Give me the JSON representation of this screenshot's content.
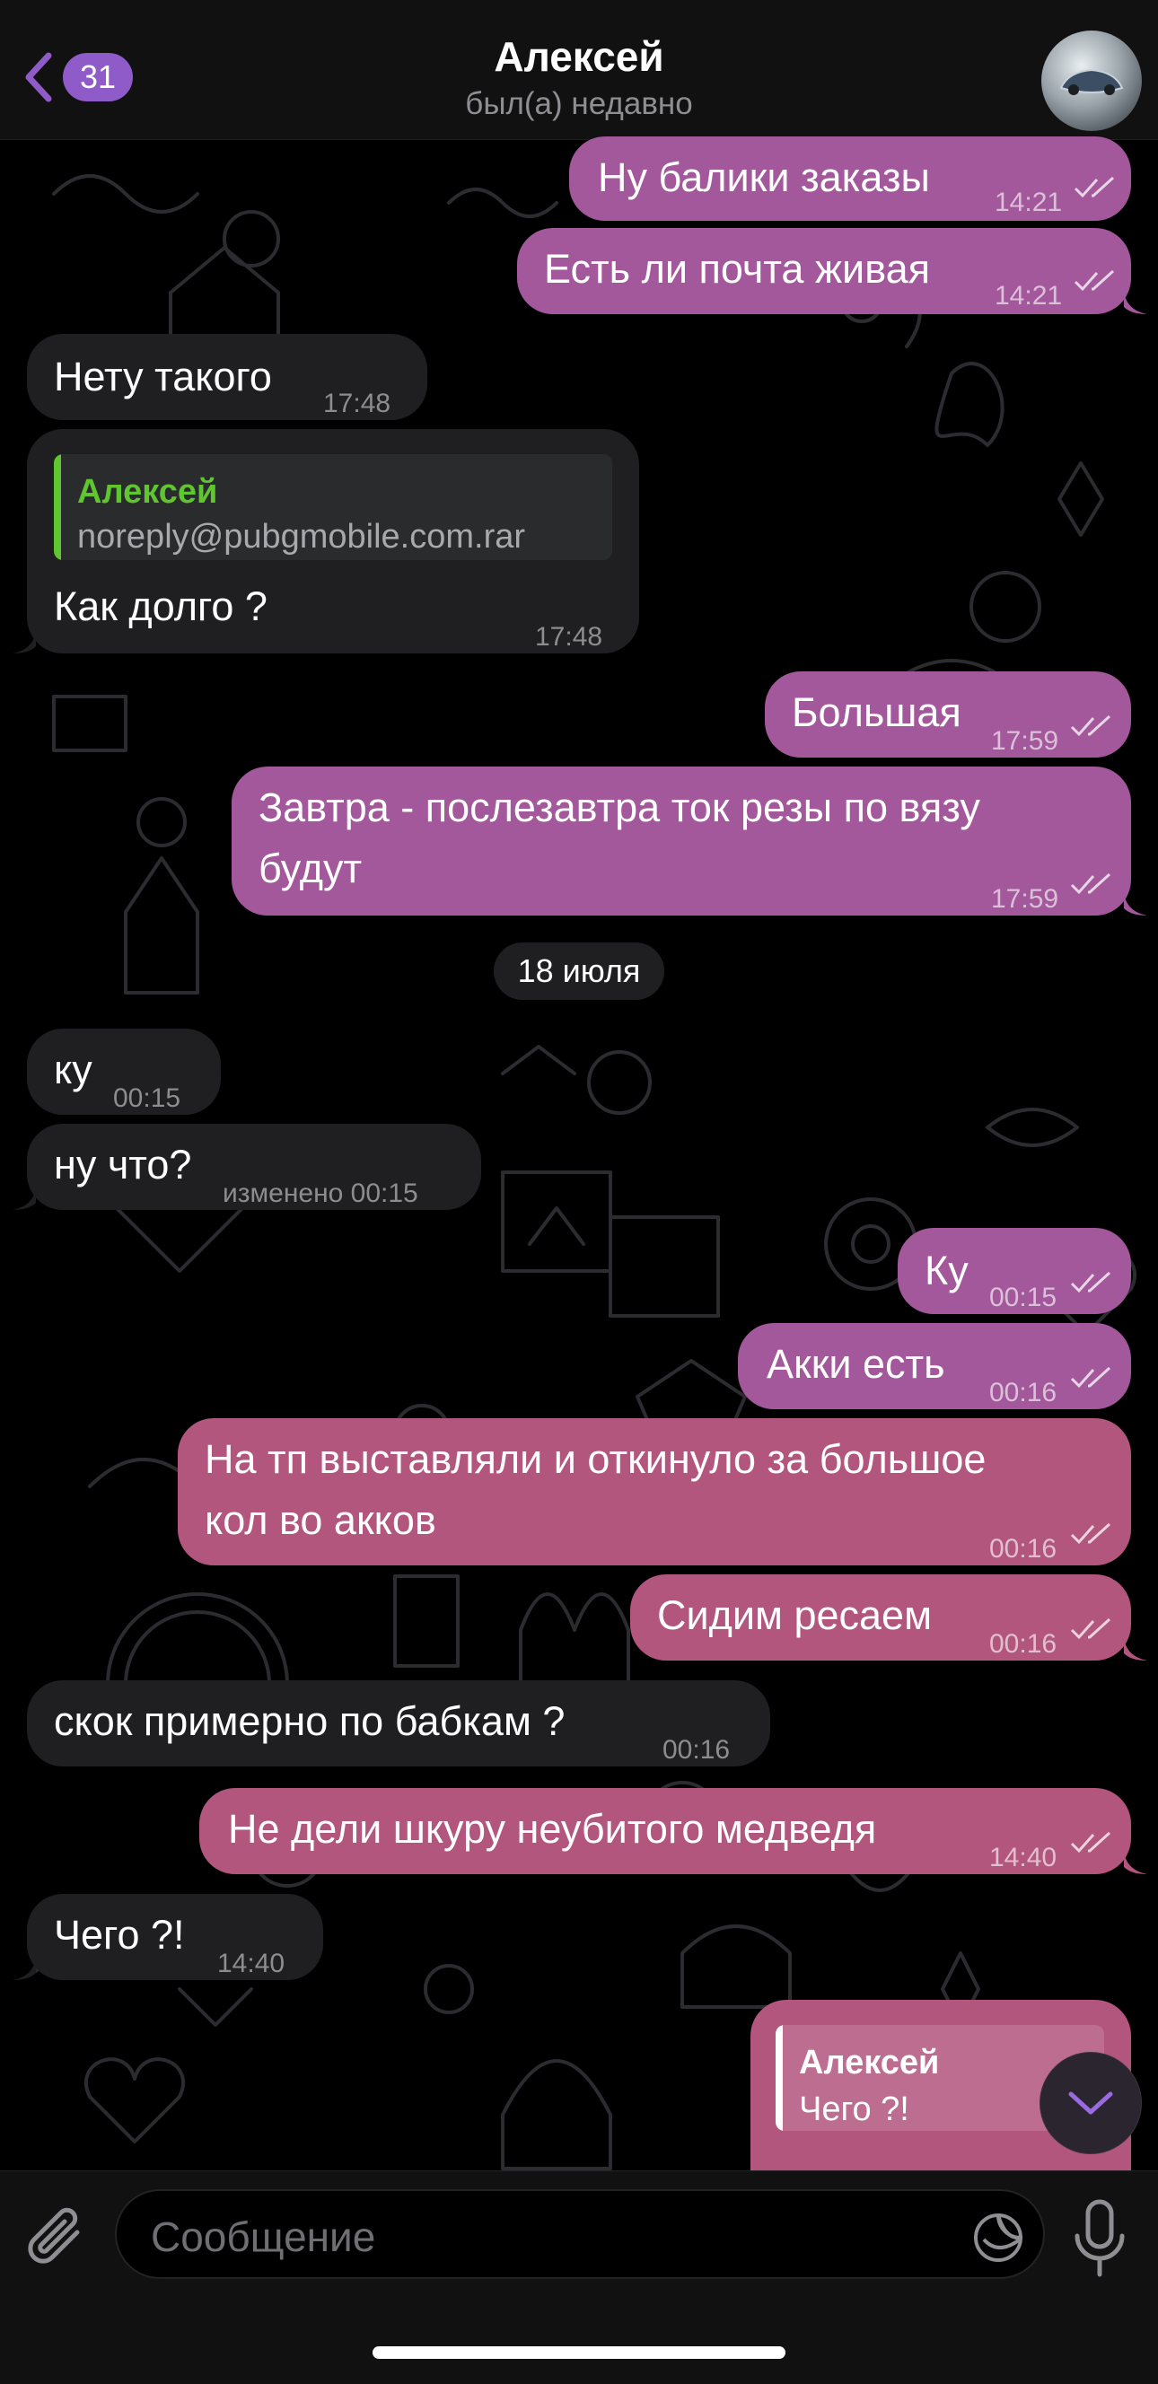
{
  "header": {
    "back_count": "31",
    "title": "Алексей",
    "subtitle": "был(а) недавно"
  },
  "messages": [
    {
      "text": "Ну балики заказы",
      "time": "14:21"
    },
    {
      "text": "Есть ли почта живая",
      "time": "14:21"
    },
    {
      "text": "Нету такого",
      "time": "17:48"
    },
    {
      "reply_name": "Алексей",
      "reply_text": "noreply@pubgmobile.com.rar",
      "text": "Как долго ?",
      "time": "17:48"
    },
    {
      "text": "Большая",
      "time": "17:59"
    },
    {
      "line1": "Завтра - послезавтра ток резы по вязу",
      "line2": "будут",
      "time": "17:59"
    },
    {
      "text": "ку",
      "time": "00:15"
    },
    {
      "text": "ну что?",
      "time": "изменено 00:15"
    },
    {
      "text": "Ку",
      "time": "00:15"
    },
    {
      "text": "Акки есть",
      "time": "00:16"
    },
    {
      "line1": "На тп выставляли и откинуло за большое",
      "line2": "кол во акков",
      "time": "00:16"
    },
    {
      "text": "Сидим ресаем",
      "time": "00:16"
    },
    {
      "text": "скок примерно по бабкам ?",
      "time": "00:16"
    },
    {
      "text": "Не дели шкуру неубитого медведя",
      "time": "14:40"
    },
    {
      "text": "Чего ?!",
      "time": "14:40"
    },
    {
      "reply_name": "Алексей",
      "reply_text": "Чего ?!"
    }
  ],
  "date_separator": "18 июля",
  "composer": {
    "placeholder": "Сообщение"
  },
  "icons": {
    "back": "chevron-left-icon",
    "attach": "paperclip-icon",
    "sticker": "sticker-icon",
    "mic": "microphone-icon",
    "scroll_down": "chevron-down-icon",
    "read_status": "double-check-icon"
  },
  "colors": {
    "accent": "#8f5bc9",
    "outgoing_bubble": "#a2589a",
    "outgoing_bubble_late": "#b2567e",
    "incoming_bubble": "#1f1f21",
    "reply_name_incoming": "#5fc62f",
    "background": "#000000"
  }
}
